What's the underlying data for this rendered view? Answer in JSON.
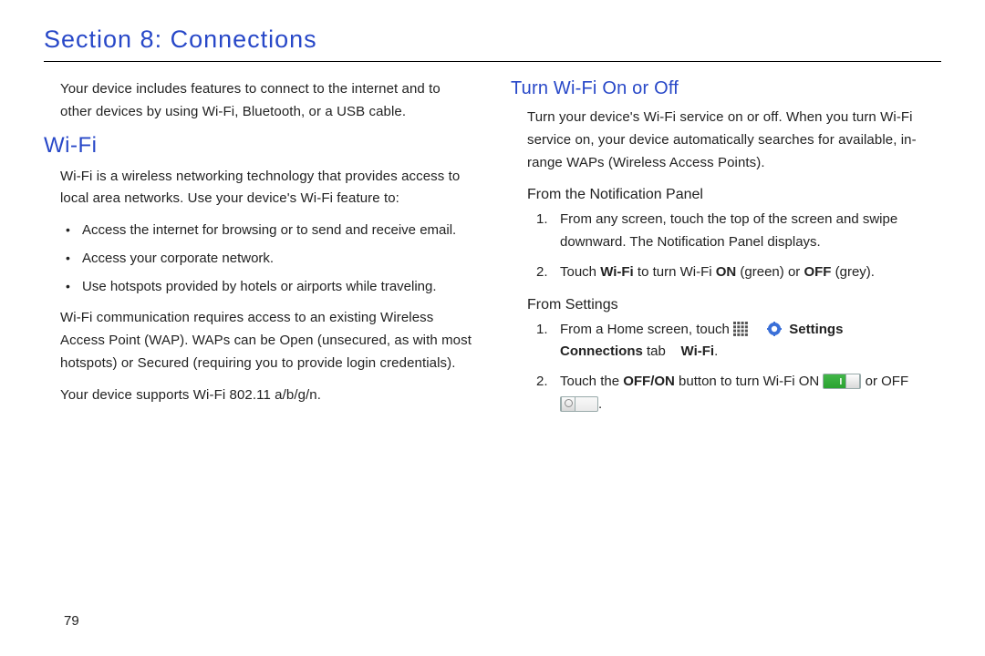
{
  "section_title": "Section 8: Connections",
  "page_number": "79",
  "left": {
    "intro": "Your device includes features to connect to the internet and to other devices by using Wi-Fi, Bluetooth, or a USB cable.",
    "wifi_heading": "Wi-Fi",
    "wifi_para1": "Wi-Fi is a wireless networking technology that provides access to local area networks. Use your device's Wi-Fi feature to:",
    "wifi_bullets": {
      "b0": "Access the internet for browsing or to send and receive email.",
      "b1": "Access your corporate network.",
      "b2": "Use hotspots provided by hotels or airports while traveling."
    },
    "wifi_para2": "Wi-Fi communication requires access to an existing Wireless Access Point (WAP). WAPs can be Open (unsecured, as with most hotspots) or Secured (requiring you to provide login credentials).",
    "wifi_para3": "Your device supports Wi-Fi 802.11 a/b/g/n."
  },
  "right": {
    "turn_heading": "Turn Wi-Fi On or Off",
    "turn_para": "Turn your device's Wi-Fi service on or off. When you turn Wi-Fi service on, your device automatically searches for available, in-range WAPs (Wireless Access Points).",
    "from_notif_heading": "From the Notification Panel",
    "notif_steps": {
      "s1": "From any screen, touch the top of the screen and swipe downward. The Notification Panel displays.",
      "s2_a": "Touch ",
      "s2_b": "Wi-Fi",
      "s2_c": " to turn Wi-Fi ",
      "s2_d": "ON",
      "s2_e": " (green) or ",
      "s2_f": "OFF",
      "s2_g": " (grey)."
    },
    "from_settings_heading": "From Settings",
    "settings_steps": {
      "s1_a": "From a Home screen, touch ",
      "s1_b": "Settings",
      "s1_c": "Connections",
      "s1_d": " tab ",
      "s1_e": "Wi-Fi",
      "s1_f": ".",
      "s2_a": "Touch the ",
      "s2_b": "OFF/ON",
      "s2_c": " button to turn Wi-Fi ON ",
      "s2_d": " or OFF ",
      "s2_e": "."
    }
  }
}
